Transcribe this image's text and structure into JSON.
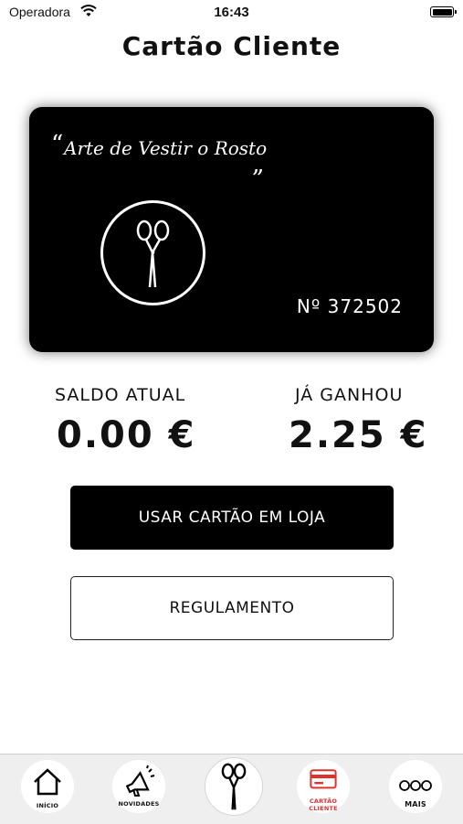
{
  "status_bar": {
    "carrier": "Operadora",
    "time": "16:43"
  },
  "title": "Cartão Cliente",
  "card": {
    "slogan": "Arte de Vestir o Rosto",
    "quote_open": "“",
    "quote_close": "„",
    "number": "Nº 372502",
    "logo_icon": "scissors-icon"
  },
  "stats": {
    "balance_label": "SALDO ATUAL",
    "balance_value": "0.00 €",
    "earned_label": "JÁ GANHOU",
    "earned_value": "2.25 €"
  },
  "buttons": {
    "use_card": "USAR CARTÃO EM LOJA",
    "rules": "REGULAMENTO"
  },
  "tabbar": {
    "items": [
      {
        "label": "INÍCIO",
        "icon": "home-icon"
      },
      {
        "label": "NOVIDADES",
        "icon": "megaphone-icon"
      },
      {
        "label": "",
        "icon": "scissors-icon"
      },
      {
        "label": "CARTÃO\nCLIENTE",
        "icon": "card-icon",
        "active": true
      },
      {
        "label": "MAIS",
        "icon": "more-icon"
      }
    ],
    "active_color": "#e0322d"
  }
}
